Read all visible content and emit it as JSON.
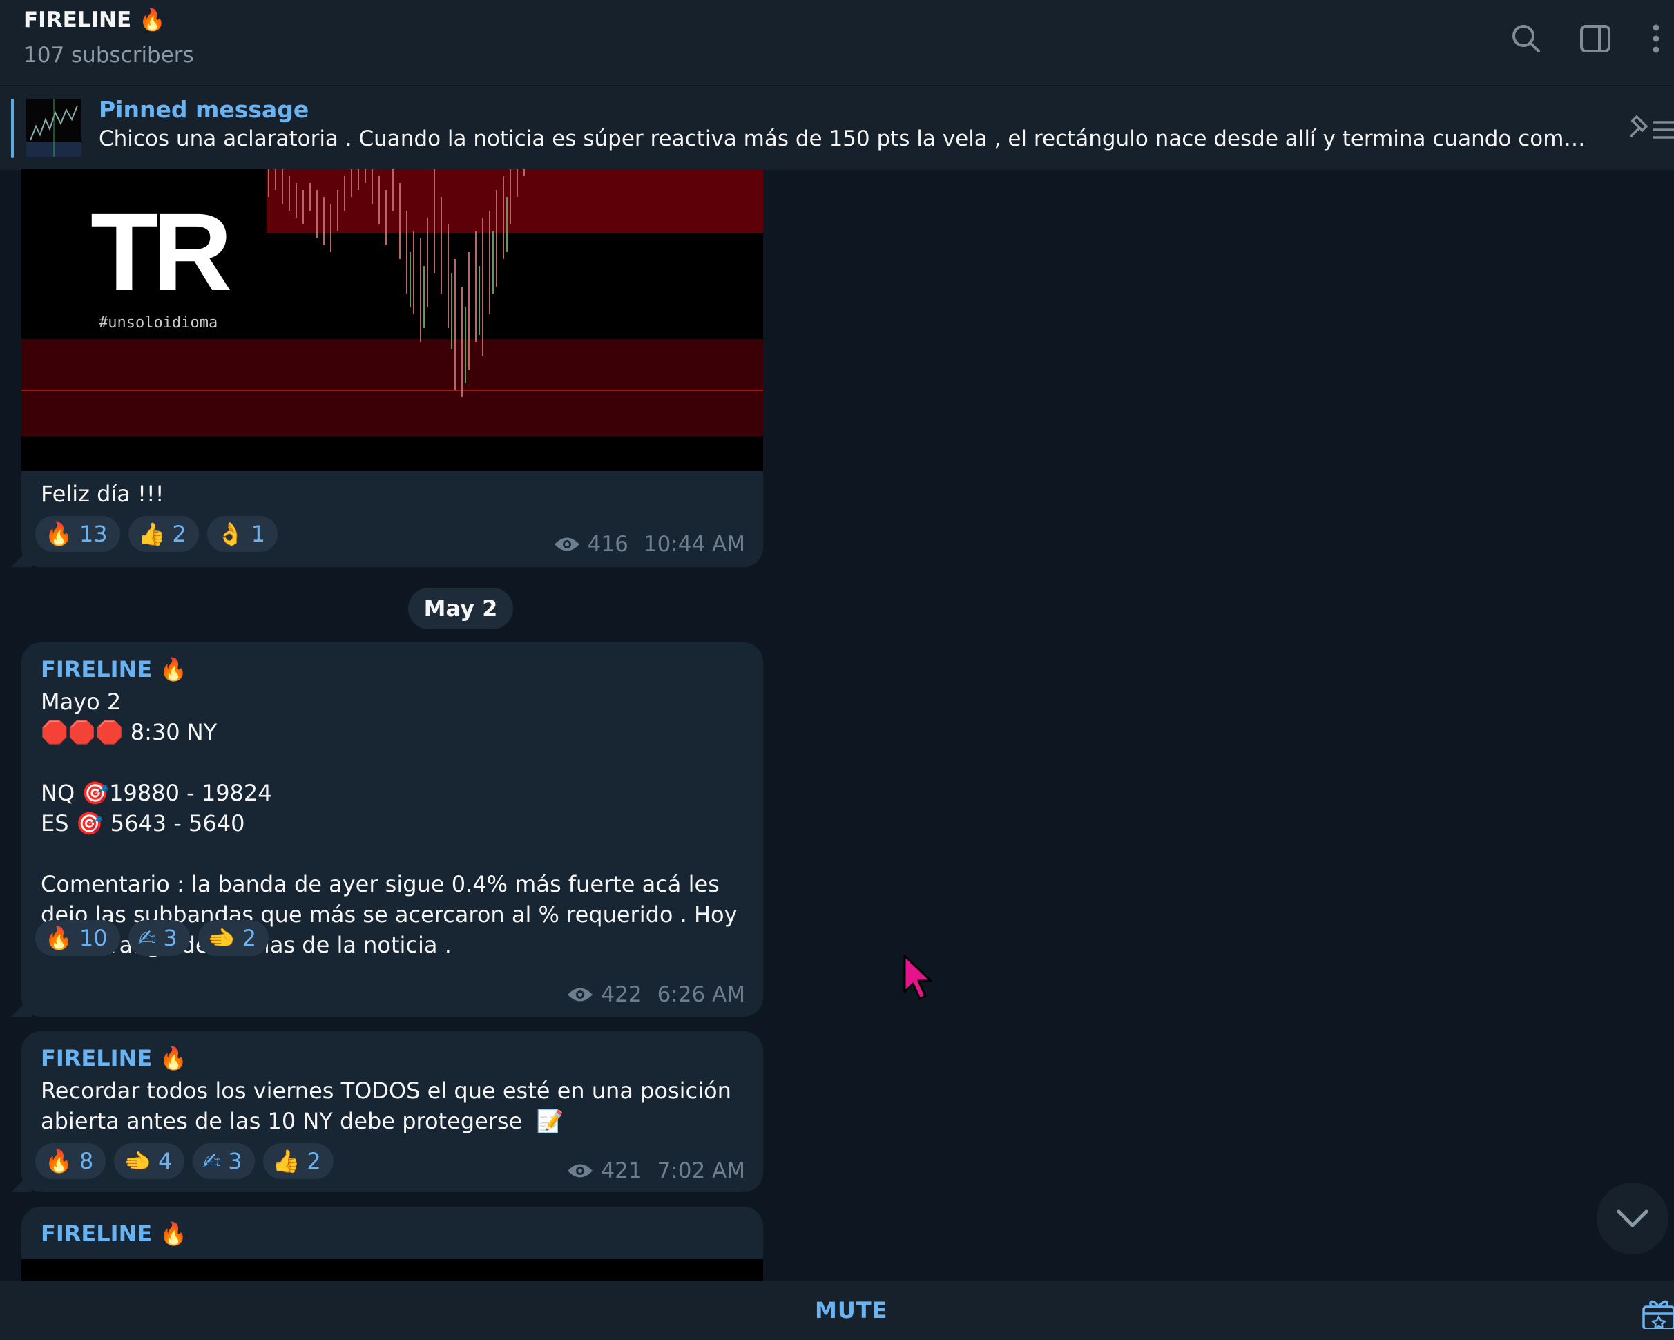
{
  "header": {
    "title": "FIRELINE 🔥",
    "subtitle": "107 subscribers",
    "icons": [
      "search-icon",
      "sidebar-toggle-icon",
      "more-vertical-icon"
    ]
  },
  "pinned": {
    "title": "Pinned message",
    "text": "Chicos una aclaratoria .  Cuando la noticia es súper reactiva más de 150 pts la vela , el rectángulo nace desde allí y termina cuando complete las..."
  },
  "messages": [
    {
      "image_text": "TR",
      "image_hashtag": "#unsoloidioma",
      "text": "Feliz día !!!",
      "reactions": [
        {
          "emoji": "🔥",
          "count": "13"
        },
        {
          "emoji": "👍",
          "count": "2"
        },
        {
          "emoji": "👌",
          "count": "1"
        }
      ],
      "views": "416",
      "time": "10:44 AM"
    },
    {
      "sender": "FIRELINE 🔥",
      "text": "Mayo 2\n🛑🛑🛑 8:30 NY\n\nNQ 🎯19880 - 19824\nES 🎯 5643 - 5640\n\nComentario : la banda de ayer sigue 0.4% más fuerte acá les dejo las subbandas que más se acercaron al % requerido . Hoy hacer rango de 5 velas de la noticia .",
      "reactions": [
        {
          "emoji": "🔥",
          "count": "10"
        },
        {
          "emoji": "✍",
          "count": "3"
        },
        {
          "emoji": "🫲",
          "count": "2"
        }
      ],
      "views": "422",
      "time": "6:26 AM"
    },
    {
      "sender": "FIRELINE 🔥",
      "text": "Recordar todos los viernes TODOS el que esté en una posición abierta antes de las 10 NY debe protegerse  📝",
      "reactions": [
        {
          "emoji": "🔥",
          "count": "8"
        },
        {
          "emoji": "🫲",
          "count": "4"
        },
        {
          "emoji": "✍",
          "count": "3"
        },
        {
          "emoji": "👍",
          "count": "2"
        }
      ],
      "views": "421",
      "time": "7:02 AM"
    },
    {
      "sender": "FIRELINE 🔥"
    }
  ],
  "date_separator": "May 2",
  "bottom": {
    "mute_label": "MUTE"
  },
  "colors": {
    "background": "#0e1621",
    "panel": "#17212b",
    "bubble": "#182533",
    "accent": "#6ab3f3"
  }
}
